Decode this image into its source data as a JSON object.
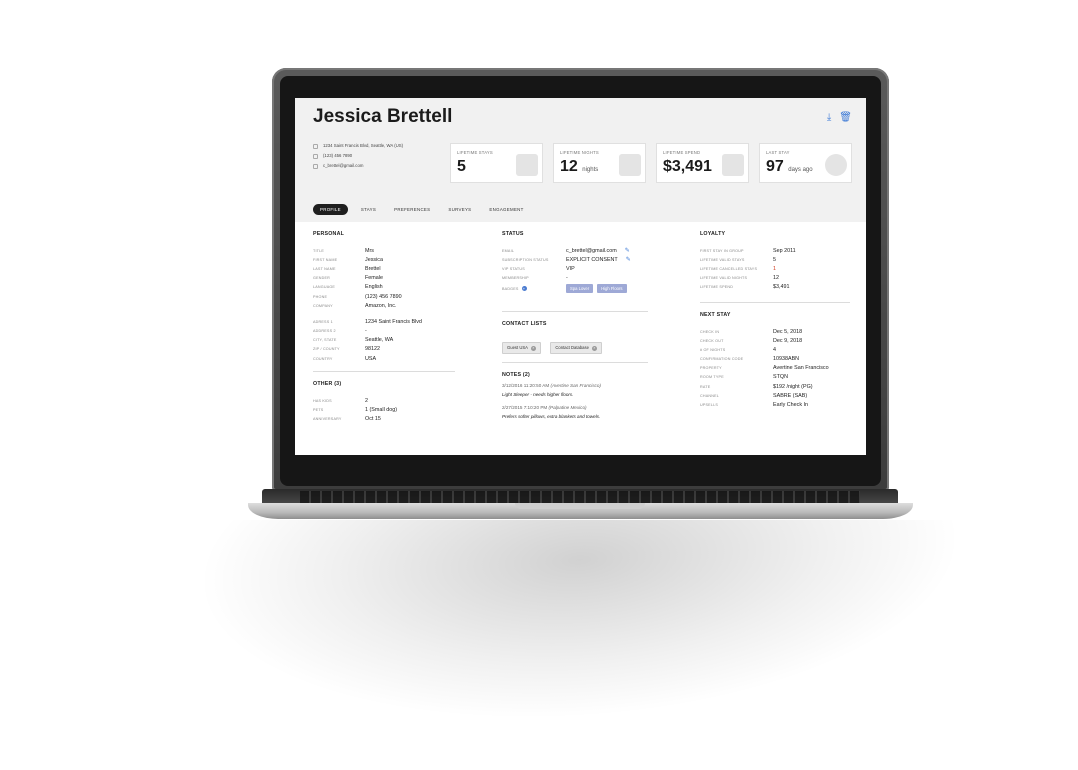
{
  "profile": {
    "name": "Jessica Brettell",
    "address": "1234 Saint Francis Blvd, Seattle, WA (US)",
    "phone": "(123) 456 7890",
    "email": "c_brettel@gmail.com"
  },
  "header_actions": {
    "download_icon": "download-icon",
    "delete_icon": "trash-icon"
  },
  "stats": [
    {
      "label": "LIFETIME STAYS",
      "value": "5",
      "unit": "",
      "icon": "calendar-icon"
    },
    {
      "label": "LIFETIME NIGHTS",
      "value": "12",
      "unit": "nights",
      "icon": "bed-icon"
    },
    {
      "label": "LIFETIME SPEND",
      "value": "$3,491",
      "unit": "",
      "icon": "wallet-icon"
    },
    {
      "label": "LAST STAY",
      "value": "97",
      "unit": "days ago",
      "icon": "clock-icon"
    }
  ],
  "tabs": [
    "PROFILE",
    "STAYS",
    "PREFERENCES",
    "SURVEYS",
    "ENGAGEMENT"
  ],
  "active_tab": "PROFILE",
  "personal": {
    "title": "PERSONAL",
    "rows": [
      {
        "k": "TITLE",
        "v": "Mrs"
      },
      {
        "k": "FIRST NAME",
        "v": "Jessica"
      },
      {
        "k": "LAST NAME",
        "v": "Brettel"
      },
      {
        "k": "GENDER",
        "v": "Female"
      },
      {
        "k": "LANGUAGE",
        "v": "English"
      },
      {
        "k": "PHONE",
        "v": "(123) 456 7890"
      },
      {
        "k": "COMPANY",
        "v": "Amazon, Inc."
      }
    ],
    "address_rows": [
      {
        "k": "ADRESS 1",
        "v": "1234 Saint Francis Blvd"
      },
      {
        "k": "ADDRESS 2",
        "v": "-"
      },
      {
        "k": "CITY, STATE",
        "v": "Seattle, WA"
      },
      {
        "k": "ZIP / COUNTY",
        "v": "98122"
      },
      {
        "k": "COUNTRY",
        "v": "USA"
      }
    ]
  },
  "other": {
    "title": "OTHER (3)",
    "rows": [
      {
        "k": "HAS KIDS",
        "v": "2"
      },
      {
        "k": "PETS",
        "v": "1 (Small dog)"
      },
      {
        "k": "ANNIVERSARY",
        "v": "Oct 15"
      }
    ]
  },
  "status": {
    "title": "STATUS",
    "rows": [
      {
        "k": "EMAIL",
        "v": "c_brettel@gmail.com"
      },
      {
        "k": "SUBSCRIPTION STATUS",
        "v": "EXPLICIT CONSENT"
      },
      {
        "k": "VIP STATUS",
        "v": "VIP"
      },
      {
        "k": "MEMBERSHIP",
        "v": "-"
      },
      {
        "k": "BADGES",
        "v": ""
      }
    ],
    "badges": [
      "Spa Lover",
      "High Floors"
    ]
  },
  "contact_lists": {
    "title": "CONTACT LISTS",
    "items": [
      "Guest USA",
      "Contact Database"
    ]
  },
  "notes": {
    "title": "NOTES (2)",
    "items": [
      {
        "time": "3/12/2016 11:20:50 AM",
        "place": "(Avertine San Francisco)",
        "text": "Light Sleeper - needs higher floors."
      },
      {
        "time": "2/27/2015 7:10:20 PM",
        "place": "(Palpatine Mexico)",
        "text": "Prefers softer pillows, extra blankets and towels."
      }
    ]
  },
  "loyalty": {
    "title": "LOYALTY",
    "rows": [
      {
        "k": "FIRST STAY IN GROUP",
        "v": "Sep 2011"
      },
      {
        "k": "LIFETIME VALID STAYS",
        "v": "5"
      },
      {
        "k": "LIFETIME CANCELLED STAYS",
        "v": "1"
      },
      {
        "k": "LIFETIME VALID NIGHTS",
        "v": "12"
      },
      {
        "k": "LIFETIME SPEND",
        "v": "$3,491"
      }
    ]
  },
  "next_stay": {
    "title": "NEXT STAY",
    "rows": [
      {
        "k": "CHECK IN",
        "v": "Dec 5, 2018"
      },
      {
        "k": "CHECK OUT",
        "v": "Dec 9, 2018"
      },
      {
        "k": "# OF NIGHTS",
        "v": "4"
      },
      {
        "k": "CONFIRMATION CODE",
        "v": "10938ABN"
      },
      {
        "k": "PROPERTY",
        "v": "Avertine San Francisco"
      },
      {
        "k": "ROOM TYPE",
        "v": "STQN"
      },
      {
        "k": "RATE",
        "v": "$192 /night (PG)"
      },
      {
        "k": "CHANNEL",
        "v": "SABRE (SAB)"
      },
      {
        "k": "UPSELLS",
        "v": "Early Check In"
      }
    ]
  },
  "colors": {
    "accent": "#3d7ad6",
    "badge": "#9ea9d6",
    "warning": "#d13a1c",
    "tab_active": "#1f1f1f"
  }
}
